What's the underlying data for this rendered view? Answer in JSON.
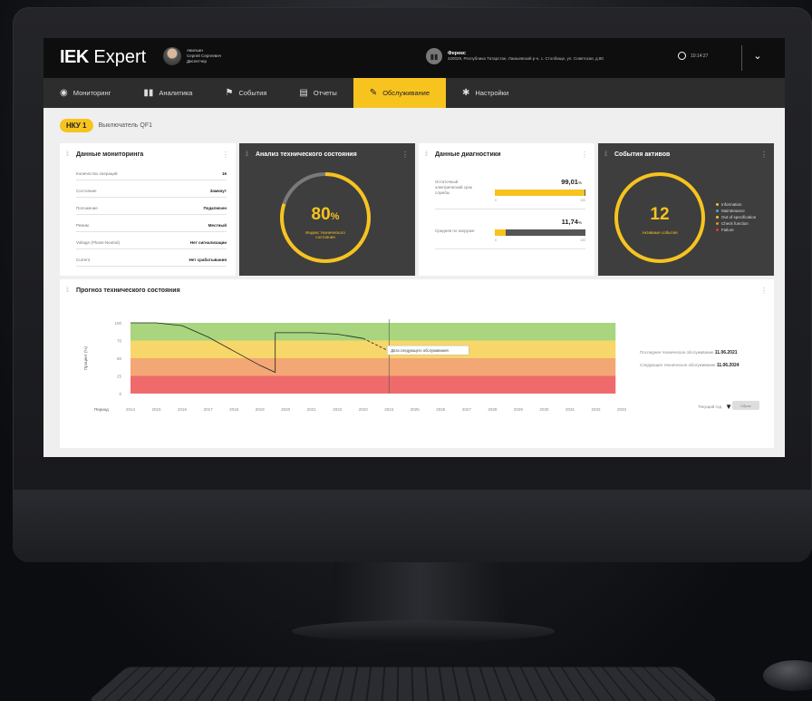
{
  "app": {
    "brand": "IEK",
    "product": "Expert"
  },
  "user": {
    "name": "Авильин\nСергей Сергеевич",
    "role": "Диспетчер"
  },
  "org": {
    "name": "Ферекс",
    "address": "420029, Республика Татарстан, Лаишевский р-н, с. Столбище, ул. Советская, д.80"
  },
  "clock": {
    "time": "10:14:27"
  },
  "nav": [
    {
      "label": "Мониторинг",
      "icon": "eye-icon"
    },
    {
      "label": "Аналитика",
      "icon": "bar-chart-icon"
    },
    {
      "label": "События",
      "icon": "flag-icon"
    },
    {
      "label": "Отчеты",
      "icon": "document-icon"
    },
    {
      "label": "Обслуживание",
      "icon": "wrench-icon",
      "active": true
    },
    {
      "label": "Настройки",
      "icon": "gear-icon"
    }
  ],
  "breadcrumb": {
    "badge": "НКУ 1",
    "item": "Выключатель QF1"
  },
  "monitoring": {
    "title": "Данные мониторинга",
    "rows": [
      {
        "label": "Количество операций",
        "value": "16"
      },
      {
        "label": "Состояние",
        "value": "Замкнут"
      },
      {
        "label": "Положение",
        "value": "Подключен"
      },
      {
        "label": "Режим",
        "value": "Местный"
      },
      {
        "label": "Voltage (Phase-Neutral)",
        "value": "Нет сигнализации"
      },
      {
        "label": "Current",
        "value": "Нет срабатывания"
      }
    ]
  },
  "tech_state": {
    "title": "Анализ технического состояния",
    "percent": 80,
    "value_text": "80",
    "unit": "%",
    "caption": "Индекс технического\nсостояния",
    "accent": "#f7c31f"
  },
  "diagnostics": {
    "title": "Данные диагностики",
    "items": [
      {
        "label": "Остаточный электрический срок службы",
        "value": "99,01",
        "unit": "%",
        "fill": 0.99,
        "min": "0",
        "max": "100"
      },
      {
        "label": "Средняя по нагрузке",
        "value": "11,74",
        "unit": "%",
        "fill": 0.1174,
        "min": "0",
        "max": "100"
      }
    ]
  },
  "events": {
    "title": "События активов",
    "count": "12",
    "caption": "Активные события",
    "legend": [
      {
        "label": "Information",
        "color": "#f7c31f",
        "prefix": "M"
      },
      {
        "label": "Maintenance",
        "color": "#4ea3e0",
        "prefix": "●"
      },
      {
        "label": "Out of specification",
        "color": "#f7c31f",
        "prefix": "●"
      },
      {
        "label": "Check function",
        "color": "#f08a24",
        "prefix": "●"
      },
      {
        "label": "Failure",
        "color": "#e53935",
        "prefix": "●"
      }
    ]
  },
  "forecast": {
    "title": "Прогноз технического состояния",
    "last_service_label": "Последнее техническое обслуживание",
    "last_service_date": "11.06.2021",
    "next_service_label": "Следующее техническое обслуживание",
    "next_service_date": "11.06.2024",
    "tooltip": "Дата следующего обслуживания",
    "filter_label": "Текущий год",
    "reset_label": "Сброс",
    "period_label": "Период",
    "ylabel": "Процент (%)"
  },
  "chart_data": {
    "type": "line",
    "title": "Прогноз технического состояния",
    "xlabel": "Период",
    "ylabel": "Процент (%)",
    "x": [
      "2014",
      "2015",
      "2016",
      "2017",
      "2018",
      "2019",
      "2020",
      "2021",
      "2022",
      "2023",
      "2024",
      "2025",
      "2026",
      "2027",
      "2028",
      "2029",
      "2030",
      "2031",
      "2032",
      "2033"
    ],
    "yticks": [
      0,
      25,
      50,
      75,
      100
    ],
    "ylim": [
      0,
      100
    ],
    "bands": [
      {
        "from": 75,
        "to": 100,
        "color": "#a8d57d"
      },
      {
        "from": 50,
        "to": 75,
        "color": "#f7d66a"
      },
      {
        "from": 25,
        "to": 50,
        "color": "#f2a774"
      },
      {
        "from": 0,
        "to": 25,
        "color": "#ef6b6b"
      }
    ],
    "series": [
      {
        "points": [
          [
            2014,
            100
          ],
          [
            2015,
            100
          ],
          [
            2016,
            96
          ],
          [
            2017,
            80
          ],
          [
            2018,
            60
          ],
          [
            2019,
            40
          ],
          [
            2019.6,
            30
          ],
          [
            2019.6,
            86
          ],
          [
            2021,
            86
          ],
          [
            2022,
            84
          ],
          [
            2023,
            78
          ]
        ],
        "style": "solid"
      },
      {
        "points": [
          [
            2023,
            78
          ],
          [
            2024,
            60
          ]
        ],
        "style": "dashed"
      }
    ],
    "marker_x": 2024,
    "grid": false
  }
}
